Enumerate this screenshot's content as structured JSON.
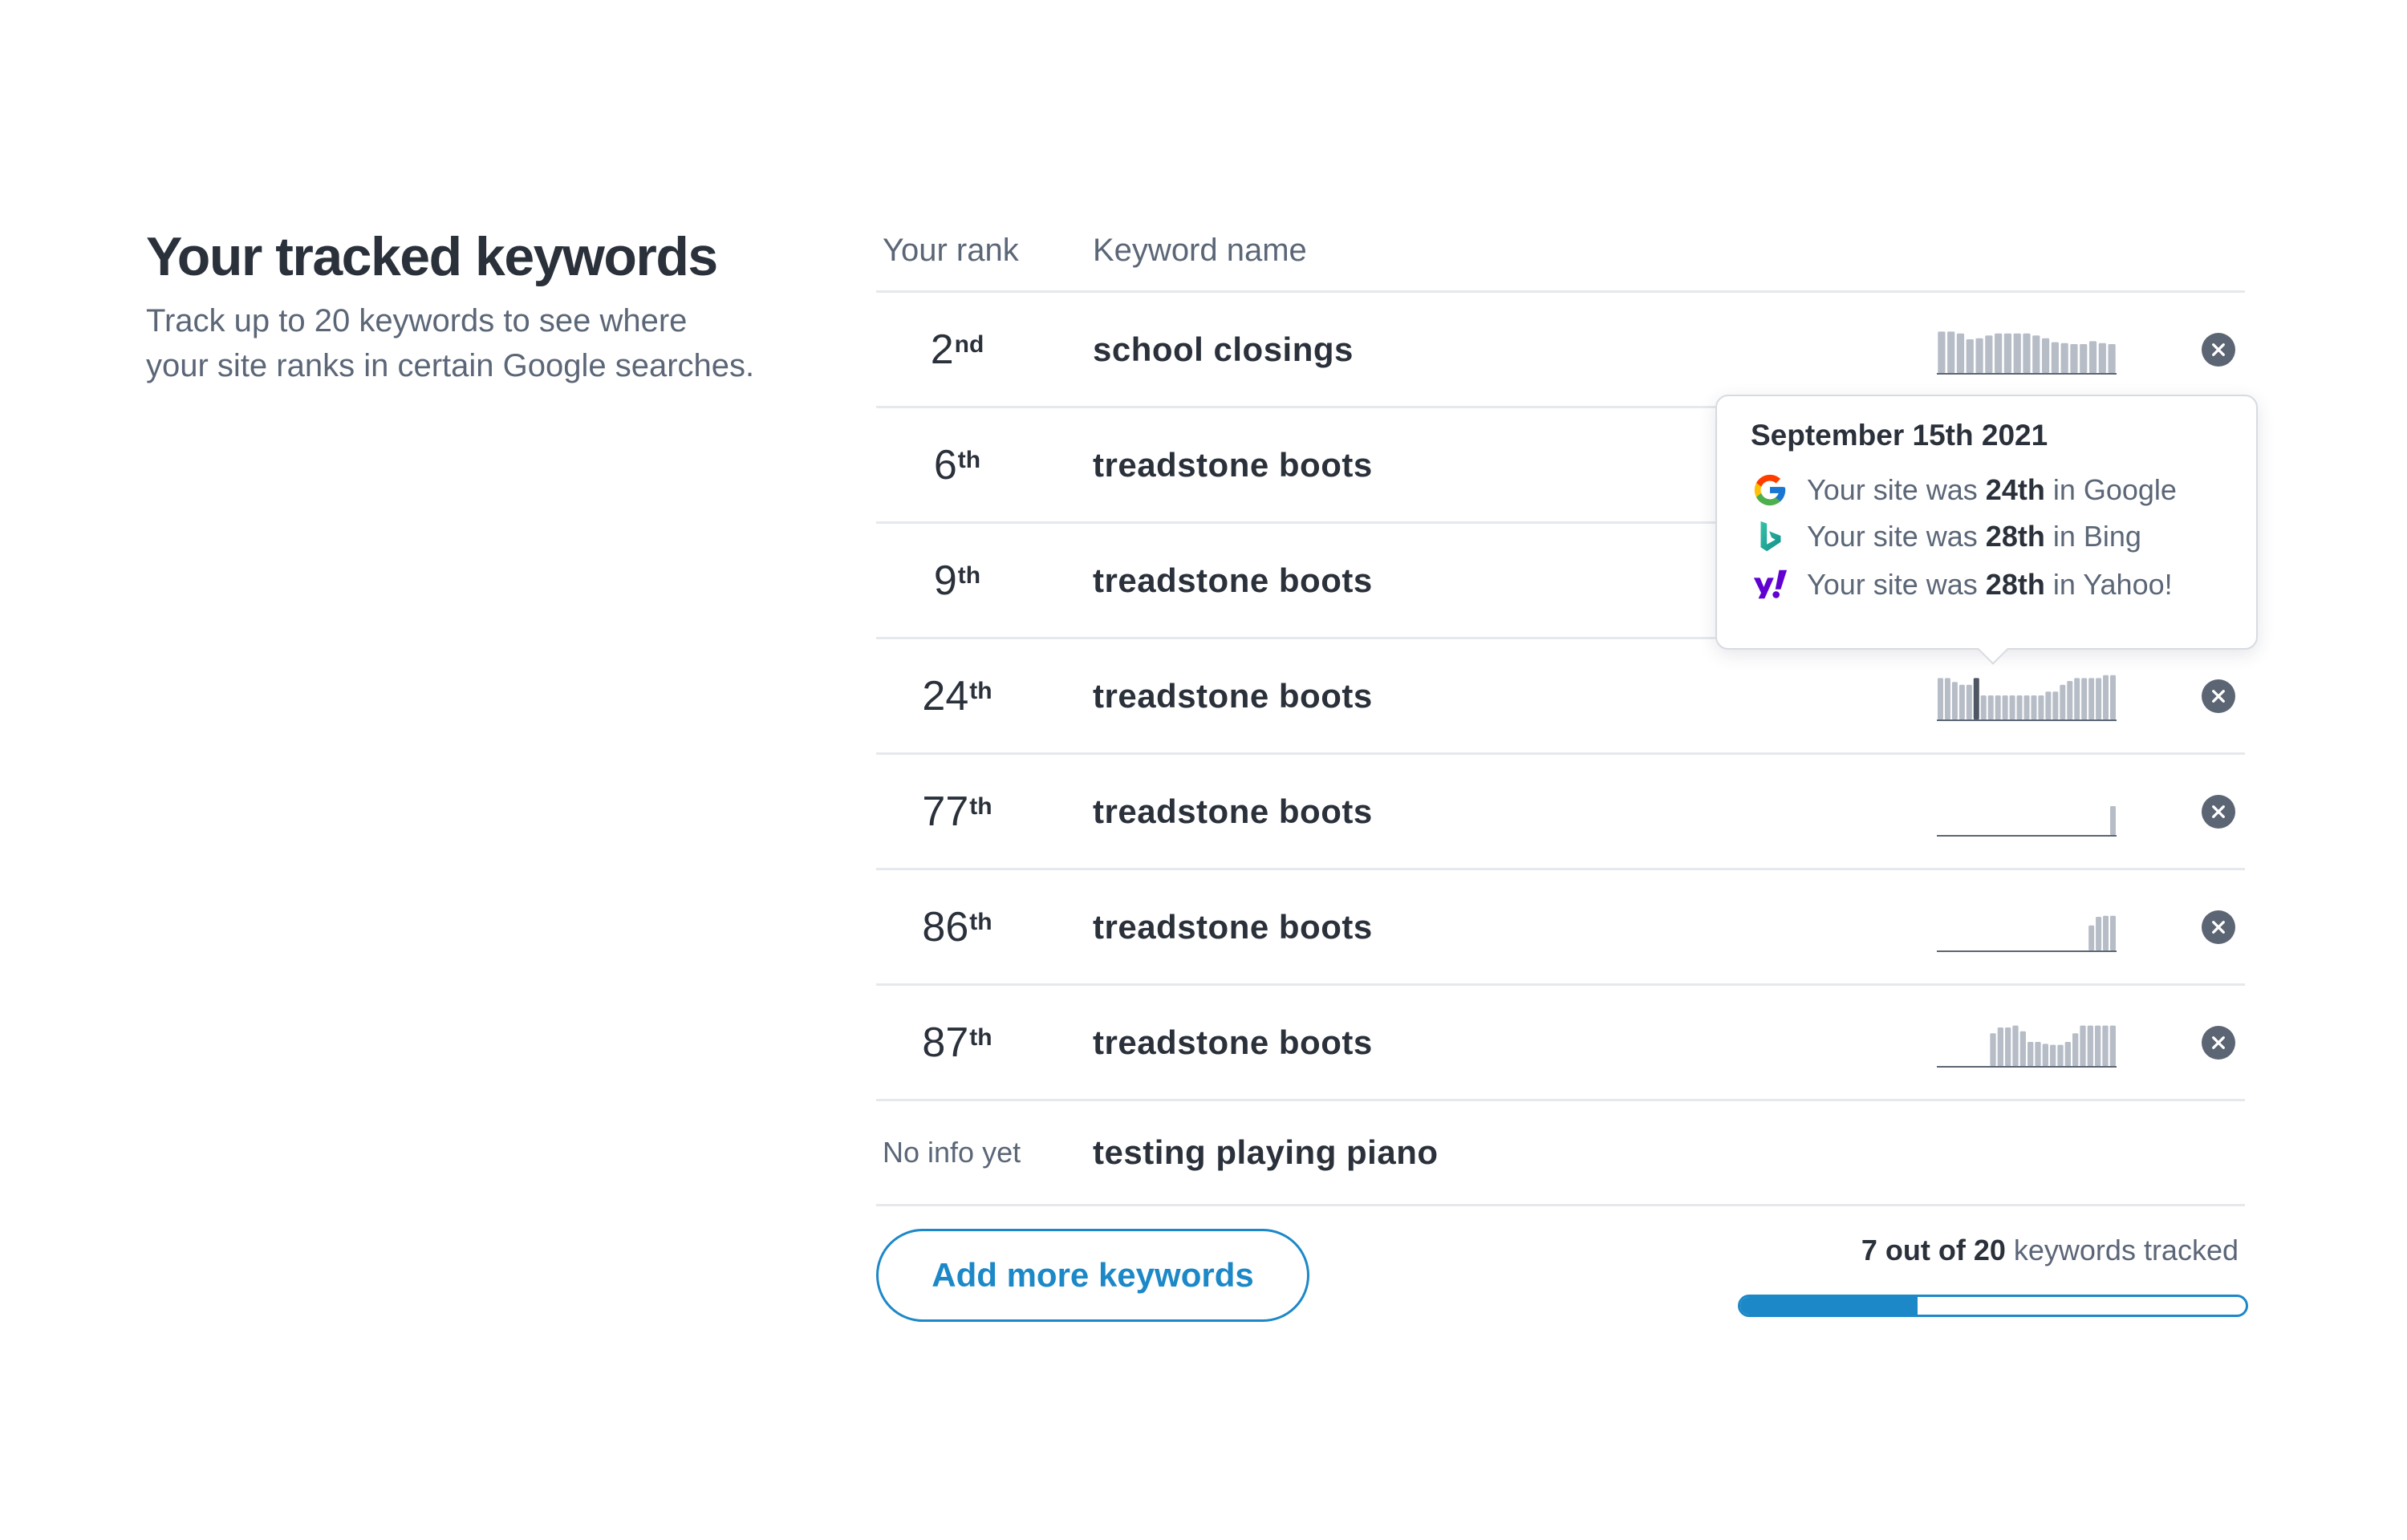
{
  "intro": {
    "title": "Your tracked keywords",
    "description": "Track up to 20 keywords to see where your site ranks in certain Google searches."
  },
  "table": {
    "headers": {
      "rank": "Your rank",
      "keyword": "Keyword name"
    },
    "rows": [
      {
        "rank": "2",
        "suffix": "nd",
        "keyword": "school closings",
        "trend": [
          0.86,
          0.86,
          0.82,
          0.7,
          0.72,
          0.78,
          0.82,
          0.82,
          0.82,
          0.82,
          0.78,
          0.72,
          0.64,
          0.62,
          0.6,
          0.6,
          0.66,
          0.62,
          0.6
        ]
      },
      {
        "rank": "6",
        "suffix": "th",
        "keyword": "treadstone boots",
        "trend": null
      },
      {
        "rank": "9",
        "suffix": "th",
        "keyword": "treadstone boots",
        "trend": null
      },
      {
        "rank": "24",
        "suffix": "th",
        "keyword": "treadstone boots",
        "trend": [
          0.86,
          0.86,
          0.78,
          0.72,
          0.72,
          0.86,
          0.5,
          0.5,
          0.5,
          0.5,
          0.5,
          0.5,
          0.5,
          0.5,
          0.5,
          0.58,
          0.58,
          0.72,
          0.8,
          0.86,
          0.86,
          0.86,
          0.86,
          0.92,
          0.92
        ],
        "highlight": 5
      },
      {
        "rank": "77",
        "suffix": "th",
        "keyword": "treadstone boots",
        "trend": [
          0,
          0,
          0,
          0,
          0,
          0,
          0,
          0,
          0,
          0,
          0,
          0,
          0,
          0,
          0,
          0,
          0,
          0,
          0,
          0,
          0,
          0,
          0,
          0,
          0.6
        ]
      },
      {
        "rank": "86",
        "suffix": "th",
        "keyword": "treadstone boots",
        "trend": [
          0,
          0,
          0,
          0,
          0,
          0,
          0,
          0,
          0,
          0,
          0,
          0,
          0,
          0,
          0,
          0,
          0,
          0,
          0,
          0,
          0,
          0.52,
          0.7,
          0.72,
          0.72
        ]
      },
      {
        "rank": "87",
        "suffix": "th",
        "keyword": "treadstone boots",
        "trend": [
          0,
          0,
          0,
          0,
          0,
          0,
          0,
          0.68,
          0.8,
          0.8,
          0.84,
          0.72,
          0.5,
          0.5,
          0.46,
          0.44,
          0.44,
          0.5,
          0.68,
          0.84,
          0.84,
          0.84,
          0.84,
          0.84
        ]
      },
      {
        "rank_text": "No info yet",
        "keyword": "testing playing piano",
        "trend": null
      }
    ]
  },
  "tooltip": {
    "date": "September 15th 2021",
    "lines": [
      {
        "engine_icon": "google-icon",
        "prefix": "Your site was",
        "rank": "24th",
        "suffix": "in Google"
      },
      {
        "engine_icon": "bing-icon",
        "prefix": "Your site was",
        "rank": "28th",
        "suffix": "in Bing"
      },
      {
        "engine_icon": "yahoo-icon",
        "prefix": "Your site was",
        "rank": "28th",
        "suffix": "in Yahoo!"
      }
    ]
  },
  "footer": {
    "add_button_label": "Add more keywords",
    "tracked_count": "7 out of 20",
    "tracked_suffix": "keywords tracked",
    "progress_fraction": 0.35
  },
  "colors": {
    "accent": "#1c88c7",
    "bar": "#b7bdc7",
    "bar_highlight": "#4e5663",
    "remove_button": "#5c6573"
  }
}
